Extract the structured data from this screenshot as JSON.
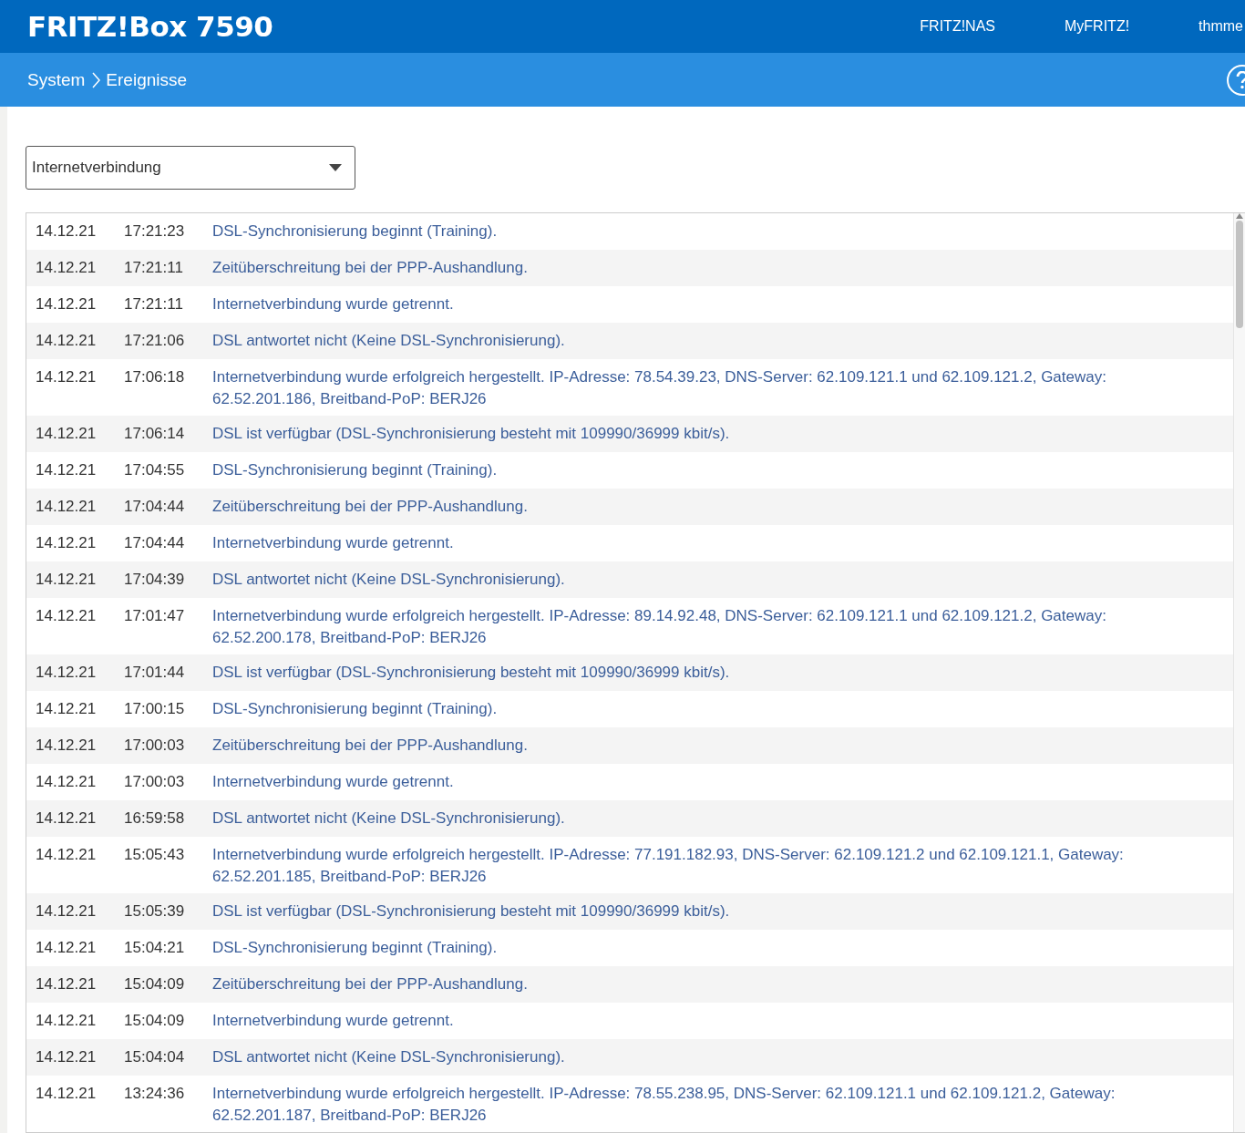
{
  "header": {
    "title": "FRITZ!Box 7590",
    "nav": [
      "FRITZ!NAS",
      "MyFRITZ!",
      "thmme"
    ]
  },
  "breadcrumb": [
    "System",
    "Ereignisse"
  ],
  "filter": {
    "value": "Internetverbindung"
  },
  "events": [
    {
      "date": "14.12.21",
      "time": "17:21:23",
      "message": "DSL-Synchronisierung beginnt (Training)."
    },
    {
      "date": "14.12.21",
      "time": "17:21:11",
      "message": "Zeitüberschreitung bei der PPP-Aushandlung."
    },
    {
      "date": "14.12.21",
      "time": "17:21:11",
      "message": "Internetverbindung wurde getrennt."
    },
    {
      "date": "14.12.21",
      "time": "17:21:06",
      "message": "DSL antwortet nicht (Keine DSL-Synchronisierung)."
    },
    {
      "date": "14.12.21",
      "time": "17:06:18",
      "message": "Internetverbindung wurde erfolgreich hergestellt. IP-Adresse: 78.54.39.23, DNS-Server: 62.109.121.1 und 62.109.121.2, Gateway: 62.52.201.186, Breitband-PoP: BERJ26"
    },
    {
      "date": "14.12.21",
      "time": "17:06:14",
      "message": "DSL ist verfügbar (DSL-Synchronisierung besteht mit 109990/36999 kbit/s)."
    },
    {
      "date": "14.12.21",
      "time": "17:04:55",
      "message": "DSL-Synchronisierung beginnt (Training)."
    },
    {
      "date": "14.12.21",
      "time": "17:04:44",
      "message": "Zeitüberschreitung bei der PPP-Aushandlung."
    },
    {
      "date": "14.12.21",
      "time": "17:04:44",
      "message": "Internetverbindung wurde getrennt."
    },
    {
      "date": "14.12.21",
      "time": "17:04:39",
      "message": "DSL antwortet nicht (Keine DSL-Synchronisierung)."
    },
    {
      "date": "14.12.21",
      "time": "17:01:47",
      "message": "Internetverbindung wurde erfolgreich hergestellt. IP-Adresse: 89.14.92.48, DNS-Server: 62.109.121.1 und 62.109.121.2, Gateway: 62.52.200.178, Breitband-PoP: BERJ26"
    },
    {
      "date": "14.12.21",
      "time": "17:01:44",
      "message": "DSL ist verfügbar (DSL-Synchronisierung besteht mit 109990/36999 kbit/s)."
    },
    {
      "date": "14.12.21",
      "time": "17:00:15",
      "message": "DSL-Synchronisierung beginnt (Training)."
    },
    {
      "date": "14.12.21",
      "time": "17:00:03",
      "message": "Zeitüberschreitung bei der PPP-Aushandlung."
    },
    {
      "date": "14.12.21",
      "time": "17:00:03",
      "message": "Internetverbindung wurde getrennt."
    },
    {
      "date": "14.12.21",
      "time": "16:59:58",
      "message": "DSL antwortet nicht (Keine DSL-Synchronisierung)."
    },
    {
      "date": "14.12.21",
      "time": "15:05:43",
      "message": "Internetverbindung wurde erfolgreich hergestellt. IP-Adresse: 77.191.182.93, DNS-Server: 62.109.121.2 und 62.109.121.1, Gateway: 62.52.201.185, Breitband-PoP: BERJ26"
    },
    {
      "date": "14.12.21",
      "time": "15:05:39",
      "message": "DSL ist verfügbar (DSL-Synchronisierung besteht mit 109990/36999 kbit/s)."
    },
    {
      "date": "14.12.21",
      "time": "15:04:21",
      "message": "DSL-Synchronisierung beginnt (Training)."
    },
    {
      "date": "14.12.21",
      "time": "15:04:09",
      "message": "Zeitüberschreitung bei der PPP-Aushandlung."
    },
    {
      "date": "14.12.21",
      "time": "15:04:09",
      "message": "Internetverbindung wurde getrennt."
    },
    {
      "date": "14.12.21",
      "time": "15:04:04",
      "message": "DSL antwortet nicht (Keine DSL-Synchronisierung)."
    },
    {
      "date": "14.12.21",
      "time": "13:24:36",
      "message": "Internetverbindung wurde erfolgreich hergestellt. IP-Adresse: 78.55.238.95, DNS-Server: 62.109.121.1 und 62.109.121.2, Gateway: 62.52.201.187, Breitband-PoP: BERJ26"
    }
  ]
}
